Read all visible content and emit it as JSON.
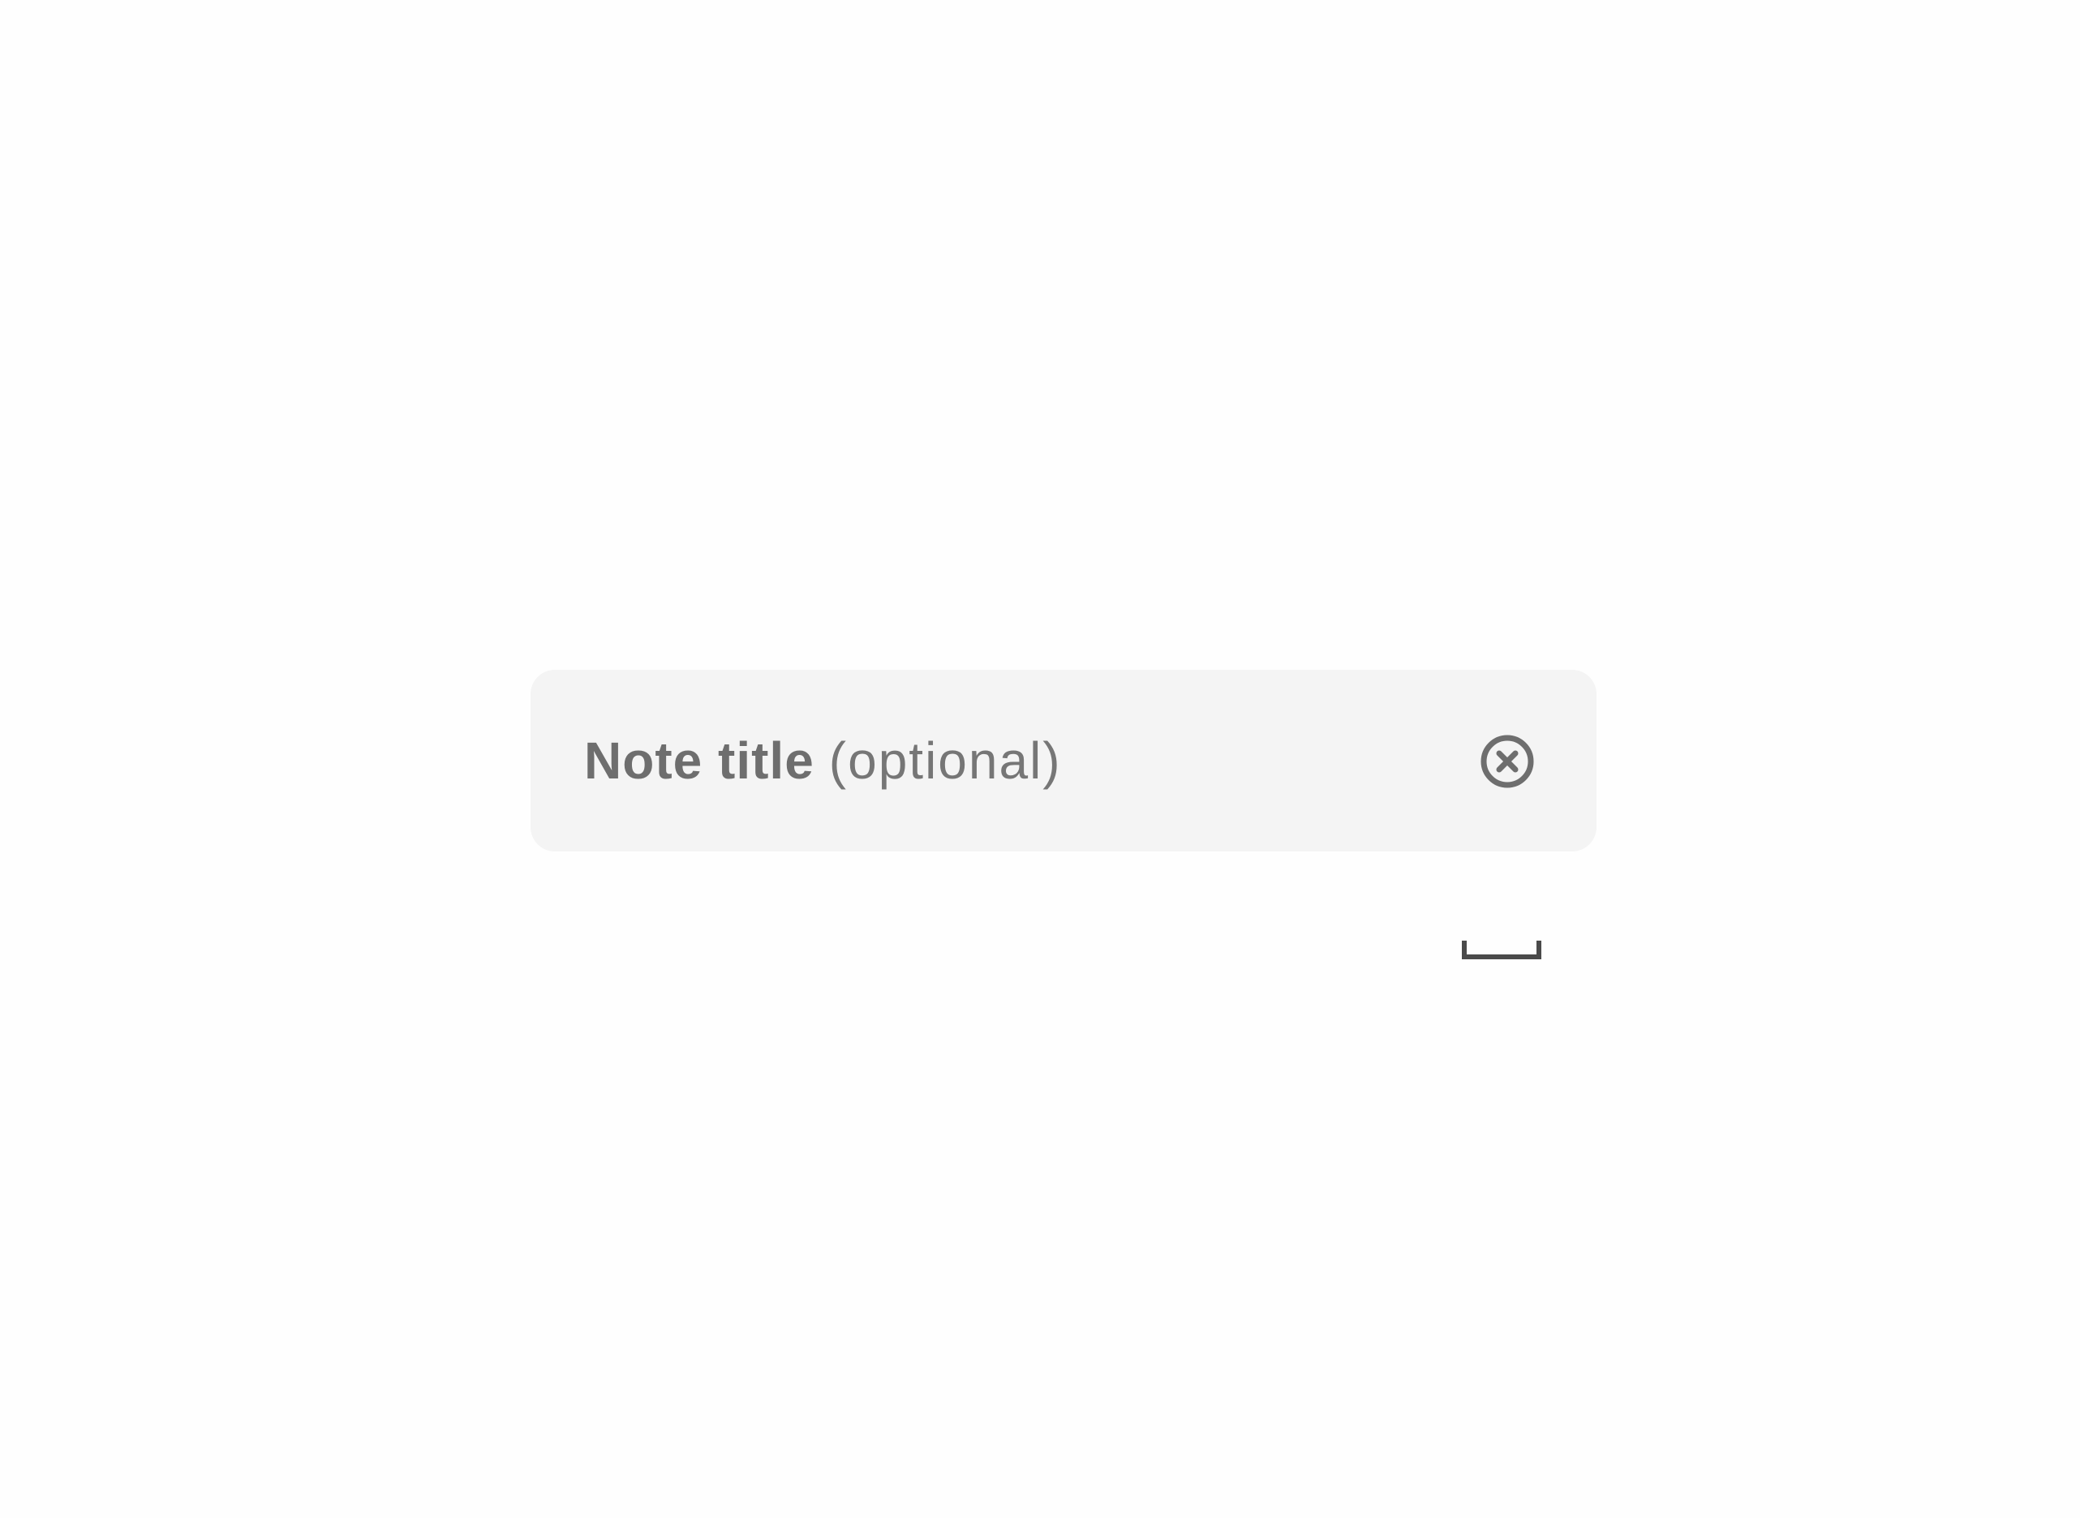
{
  "title_field": {
    "label": "Note title",
    "hint": "(optional)",
    "clear_icon": "close-circle-icon"
  },
  "keyboard": {
    "space_icon": "space-bar-icon"
  },
  "colors": {
    "background": "#fefefe",
    "field_background": "#f4f4f4",
    "label_text": "#6e6e6e",
    "icon": "#6e6e6e",
    "space_icon": "#4a4a4a"
  }
}
